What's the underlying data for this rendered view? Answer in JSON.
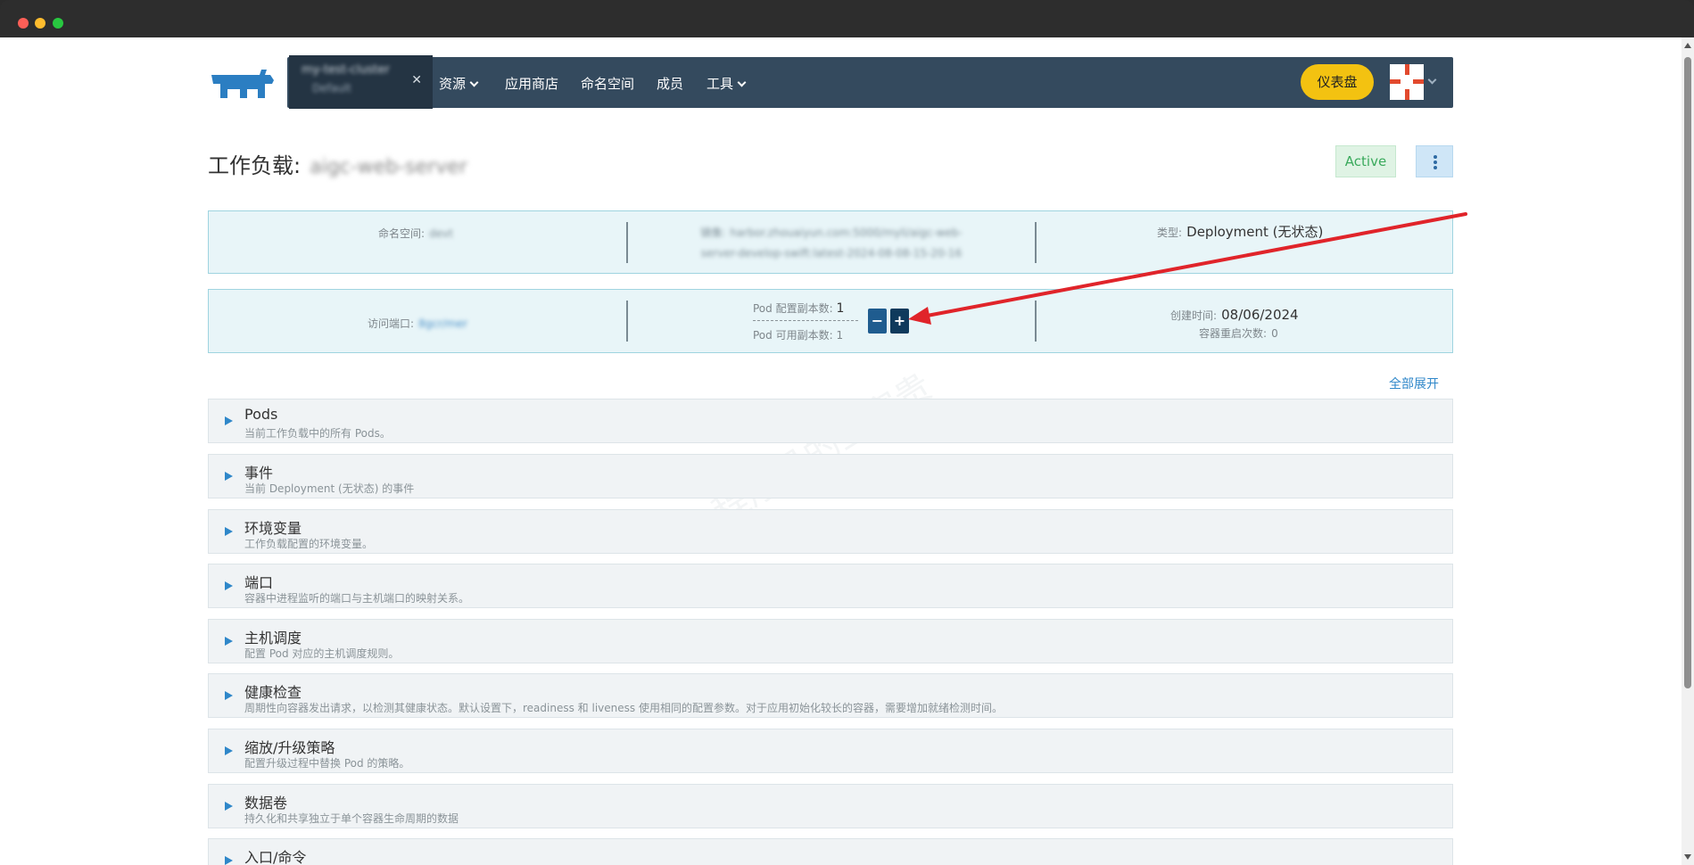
{
  "nav": {
    "cluster_name": "my-test-cluster",
    "cluster_project": "Default",
    "cluster_close": "✕",
    "items": [
      {
        "label": "资源",
        "has_chevron": true
      },
      {
        "label": "应用商店",
        "has_chevron": false
      },
      {
        "label": "命名空间",
        "has_chevron": false
      },
      {
        "label": "成员",
        "has_chevron": false
      },
      {
        "label": "工具",
        "has_chevron": true
      }
    ],
    "dashboard_button": "仪表盘"
  },
  "workload": {
    "title_prefix": "工作负载:",
    "name": "aigc-web-server",
    "status": "Active"
  },
  "info_row_1": {
    "namespace_label": "命名空间:",
    "namespace_value": "devt",
    "image_label": "镜像:",
    "image_value_line1": "harbor.zhouaiyun.com:5000/myli/aigc-web-",
    "image_value_line2": "server-develop-swift:latest-2024-08-08-15-20-16",
    "type_label": "类型:",
    "type_value": "Deployment (无状态)"
  },
  "info_row_2": {
    "port_label": "访问端口:",
    "port_value": "8gcr/mer",
    "replica_config_label": "Pod 配置副本数:",
    "replica_config_value": "1",
    "replica_available_label": "Pod 可用副本数:",
    "replica_available_value": "1",
    "decrease_label": "−",
    "increase_label": "+",
    "created_label": "创建时间:",
    "created_value": "08/06/2024",
    "restart_label": "容器重启次数:",
    "restart_value": "0"
  },
  "expand_all": "全部展开",
  "sections": [
    {
      "title": "Pods",
      "desc": "当前工作负载中的所有 Pods。"
    },
    {
      "title": "事件",
      "desc": "当前 Deployment (无状态) 的事件"
    },
    {
      "title": "环境变量",
      "desc": "工作负载配置的环境变量。"
    },
    {
      "title": "端口",
      "desc": "容器中进程监听的端口与主机端口的映射关系。"
    },
    {
      "title": "主机调度",
      "desc": "配置 Pod 对应的主机调度规则。"
    },
    {
      "title": "健康检查",
      "desc": "周期性向容器发出请求，以检测其健康状态。默认设置下，readiness 和 liveness 使用相同的配置参数。对于应用初始化较长的容器，需要增加就绪检测时间。"
    },
    {
      "title": "缩放/升级策略",
      "desc": "配置升级过程中替换 Pod 的策略。"
    },
    {
      "title": "数据卷",
      "desc": "持久化和共享独立于单个容器生命周期的数据"
    },
    {
      "title": "入口/命令",
      "desc": ""
    }
  ],
  "watermark": "程序员的王富贵",
  "colors": {
    "navbar": "#344a5e",
    "accent_blue": "#2f87c9",
    "status_green": "#3aaa5c",
    "dashboard_yellow": "#f3c211",
    "annotation_red": "#e0242a"
  }
}
